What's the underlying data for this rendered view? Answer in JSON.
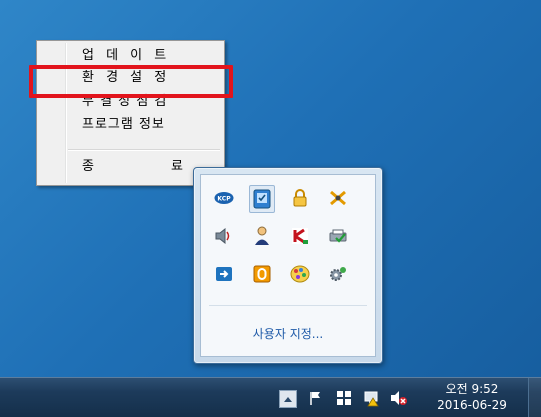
{
  "context_menu": {
    "items": [
      {
        "label": "업 데 이 트"
      },
      {
        "label": "환 경 설 정"
      },
      {
        "label": "무 결 성 점 검"
      },
      {
        "label": "프로그램 정보"
      }
    ],
    "exit": {
      "label_left": "종",
      "label_right": "료"
    }
  },
  "tray_flyout": {
    "icons": [
      {
        "icon": "kcp-icon"
      },
      {
        "icon": "security-shield-icon"
      },
      {
        "icon": "lock-icon"
      },
      {
        "icon": "network-x-icon"
      },
      {
        "icon": "volume-icon"
      },
      {
        "icon": "user-agent-icon"
      },
      {
        "icon": "kaspersky-icon"
      },
      {
        "icon": "printer-check-icon"
      },
      {
        "icon": "remote-arrow-icon"
      },
      {
        "icon": "orange-o-icon"
      },
      {
        "icon": "palette-icon"
      },
      {
        "icon": "gear-network-icon"
      }
    ],
    "customize_label": "사용자 지정..."
  },
  "taskbar": {
    "clock_time": "오전 9:52",
    "clock_date": "2016-06-29"
  },
  "colors": {
    "highlight": "#e2141c",
    "desktop": "#1f70b6",
    "taskbar": "#1d3b5b"
  }
}
